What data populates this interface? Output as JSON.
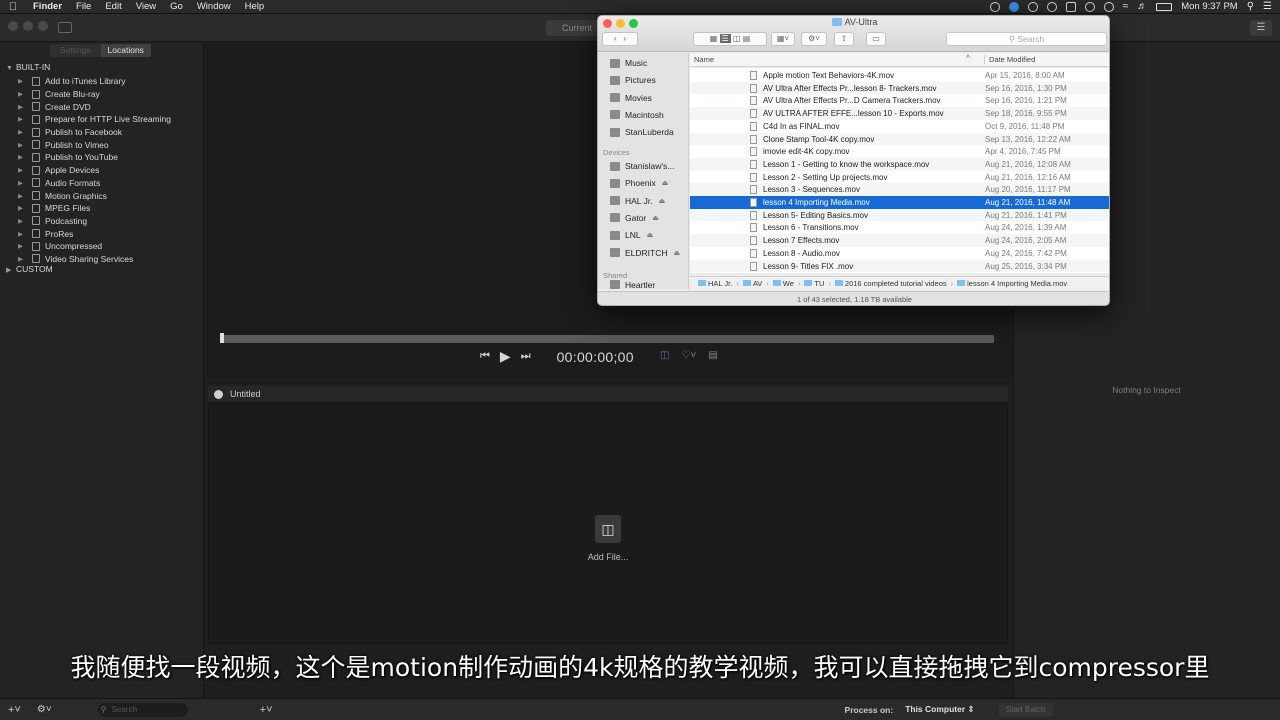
{
  "menubar": {
    "app_name": "Finder",
    "menus": [
      "File",
      "Edit",
      "View",
      "Go",
      "Window",
      "Help"
    ],
    "clock": "Mon 9:37 PM"
  },
  "toolbar": {
    "current_tab": "Current"
  },
  "left_pane": {
    "tabs": [
      "Settings",
      "Locations"
    ],
    "active_tab": "Locations",
    "builtin_label": "BUILT-IN",
    "builtin_items": [
      "Add to iTunes Library",
      "Create Blu-ray",
      "Create DVD",
      "Prepare for HTTP Live Streaming",
      "Publish to Facebook",
      "Publish to Vimeo",
      "Publish to YouTube",
      "Apple Devices",
      "Audio Formats",
      "Motion Graphics",
      "MPEG Files",
      "Podcasting",
      "ProRes",
      "Uncompressed",
      "Video Sharing Services"
    ],
    "custom_label": "CUSTOM"
  },
  "viewer": {
    "timecode": "00:00:00;00"
  },
  "batch": {
    "title": "Untitled",
    "add_file_label": "Add File..."
  },
  "inspector": {
    "empty_text": "Nothing to Inspect"
  },
  "bottom_bar": {
    "search_placeholder": "Search",
    "process_on_label": "Process on:",
    "process_on_value": "This Computer",
    "start_batch_label": "Start Batch"
  },
  "finder": {
    "title": "AV-Ultra",
    "search_placeholder": "Search",
    "sidebar_favorites": [
      "Music",
      "Pictures",
      "Movies",
      "Macintosh",
      "StanLuberda"
    ],
    "devices_label": "Devices",
    "devices": [
      "Stanislaw's...",
      "Phoenix",
      "HAL Jr.",
      "Gator",
      "LNL",
      "ELDRITCH"
    ],
    "shared_label": "Shared",
    "shared": [
      "Heartler"
    ],
    "col_name": "Name",
    "col_date": "Date Modified",
    "files": [
      {
        "name": "Apple motion Text Behaviors-4K.mov",
        "date": "Apr 15, 2016, 8:00 AM"
      },
      {
        "name": "AV Ultra After Effects Pr...lesson 8- Trackers.mov",
        "date": "Sep 16, 2016, 1:30 PM"
      },
      {
        "name": "AV Ultra After Effects Pr...D Camera Trackers.mov",
        "date": "Sep 16, 2016, 1:21 PM"
      },
      {
        "name": "AV ULTRA AFTER EFFE...lesson 10 - Exports.mov",
        "date": "Sep 18, 2016, 9:55 PM"
      },
      {
        "name": "C4d In as FINAL.mov",
        "date": "Oct 9, 2016, 11:48 PM"
      },
      {
        "name": "Clone Stamp Tool-4K copy.mov",
        "date": "Sep 13, 2016, 12:22 AM"
      },
      {
        "name": "imovie edit-4K copy.mov",
        "date": "Apr 4, 2016, 7:45 PM"
      },
      {
        "name": "Lesson 1 - Getting to know the workspace.mov",
        "date": "Aug 21, 2016, 12:08 AM"
      },
      {
        "name": "Lesson 2 -  Setting Up projects.mov",
        "date": "Aug 21, 2016, 12:16 AM"
      },
      {
        "name": "Lesson 3 -  Sequences.mov",
        "date": "Aug 20, 2016, 11:17 PM"
      },
      {
        "name": "lesson 4 Importing Media.mov",
        "date": "Aug 21, 2016, 11:48 AM"
      },
      {
        "name": "Lesson 5- Editing Basics.mov",
        "date": "Aug 21, 2016, 1:41 PM"
      },
      {
        "name": "Lesson 6 - Transitions.mov",
        "date": "Aug 24, 2016, 1:39 AM"
      },
      {
        "name": "Lesson 7 Effects.mov",
        "date": "Aug 24, 2016, 2:05 AM"
      },
      {
        "name": "Lesson 8 - Audio.mov",
        "date": "Aug 24, 2016, 7:42 PM"
      },
      {
        "name": "Lesson 9- Titles FIX .mov",
        "date": "Aug 25, 2016, 3:34 PM"
      }
    ],
    "selected_index": 10,
    "pathbar": [
      "HAL Jr.",
      "AV",
      "We",
      "TU",
      "2016 completed tutorial videos",
      "lesson 4 Importing Media.mov"
    ],
    "status": "1 of 43 selected, 1.18 TB available"
  },
  "subtitle": "我随便找一段视频，这个是motion制作动画的4k规格的教学视频，我可以直接拖拽它到compressor里"
}
